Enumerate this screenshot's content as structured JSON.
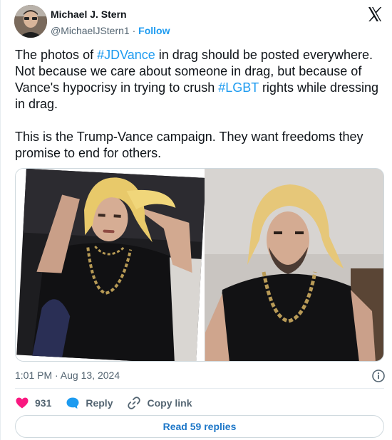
{
  "author": {
    "name": "Michael J. Stern",
    "handle": "@MichaelJStern1",
    "separator": "·",
    "follow_label": "Follow"
  },
  "post": {
    "line1_prefix": "The photos of ",
    "hashtag1": "#JDVance",
    "line1_suffix": " in drag should be posted everywhere.  Not because we care about someone in drag, but because of Vance's hypocrisy in trying to crush ",
    "hashtag2": "#LGBT",
    "line1_end": " rights while dressing in drag.",
    "paragraph2": "This is the Trump-Vance campaign.  They want freedoms they promise to end for others."
  },
  "timestamp": "1:01 PM · Aug 13, 2024",
  "actions": {
    "likes": "931",
    "reply_label": "Reply",
    "copy_link_label": "Copy link"
  },
  "read_replies_label": "Read 59 replies",
  "icons": {
    "brand": "x-logo-icon",
    "like": "heart-icon",
    "reply": "speech-bubble-icon",
    "copy": "link-icon",
    "info": "info-icon"
  },
  "colors": {
    "accent": "#1d9bf0",
    "like": "#f91880",
    "text": "#0f1419",
    "muted": "#536471"
  }
}
